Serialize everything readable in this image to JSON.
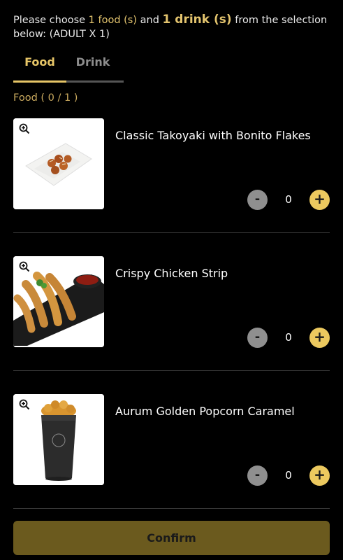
{
  "instructions": {
    "part1": "Please choose ",
    "food_count": "1 food (s)",
    "part2": " and ",
    "drink_count": "1 drink (s)",
    "part3": " from the selection below: (ADULT X 1)"
  },
  "tabs": [
    {
      "label": "Food",
      "active": true
    },
    {
      "label": "Drink",
      "active": false
    }
  ],
  "section_label": "Food ( 0 / 1 )",
  "items": [
    {
      "name": "Classic Takoyaki with Bonito Flakes",
      "quantity": "0",
      "minus": "-",
      "plus": "+"
    },
    {
      "name": "Crispy Chicken Strip",
      "quantity": "0",
      "minus": "-",
      "plus": "+"
    },
    {
      "name": "Aurum Golden Popcorn Caramel",
      "quantity": "0",
      "minus": "-",
      "plus": "+"
    }
  ],
  "confirm_label": "Confirm",
  "colors": {
    "accent": "#e6c567",
    "confirm_bg": "#6b5a1e",
    "background": "#000000"
  },
  "icons": {
    "zoom": "zoom-in-icon"
  }
}
